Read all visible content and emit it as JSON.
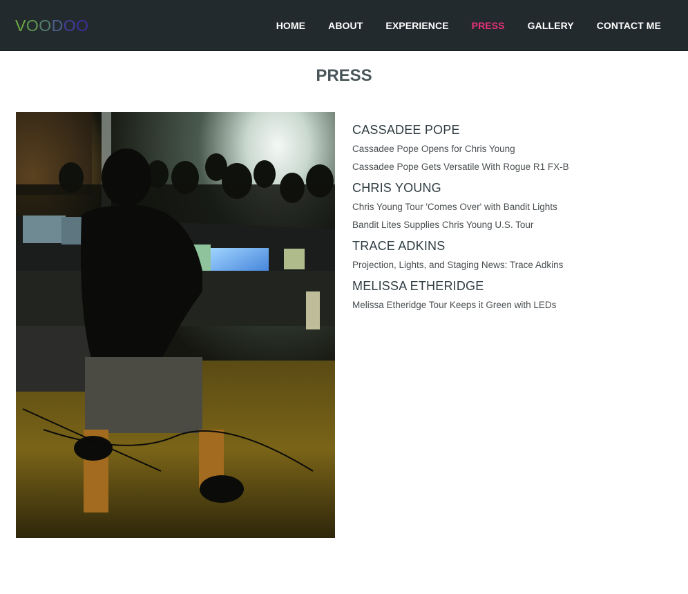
{
  "brand": {
    "letters": [
      "V",
      "O",
      "O",
      "D",
      "O",
      "O"
    ],
    "colors": [
      "#6dab43",
      "#5f9a51",
      "#557f6b",
      "#4a5f8a",
      "#433f9c",
      "#3b2f9e"
    ]
  },
  "nav": {
    "items": [
      {
        "label": "HOME",
        "active": false
      },
      {
        "label": "ABOUT",
        "active": false
      },
      {
        "label": "EXPERIENCE",
        "active": false
      },
      {
        "label": "PRESS",
        "active": true
      },
      {
        "label": "GALLERY",
        "active": false
      },
      {
        "label": "CONTACT ME",
        "active": false
      }
    ],
    "active_color": "#e8317a"
  },
  "page": {
    "title": "PRESS"
  },
  "press": [
    {
      "artist": "CASSADEE POPE",
      "links": [
        "Cassadee Pope Opens for Chris Young",
        "Cassadee Pope Gets Versatile With Rogue R1 FX-B"
      ]
    },
    {
      "artist": "CHRIS YOUNG",
      "links": [
        "Chris Young Tour 'Comes Over' with Bandit Lights",
        "Bandit Lites Supplies Chris Young U.S. Tour"
      ]
    },
    {
      "artist": "TRACE ADKINS",
      "links": [
        "Projection, Lights, and Staging News: Trace Adkins"
      ]
    },
    {
      "artist": "MELISSA ETHERIDGE",
      "links": [
        "Melissa Etheridge Tour Keeps it Green with LEDs"
      ]
    }
  ]
}
